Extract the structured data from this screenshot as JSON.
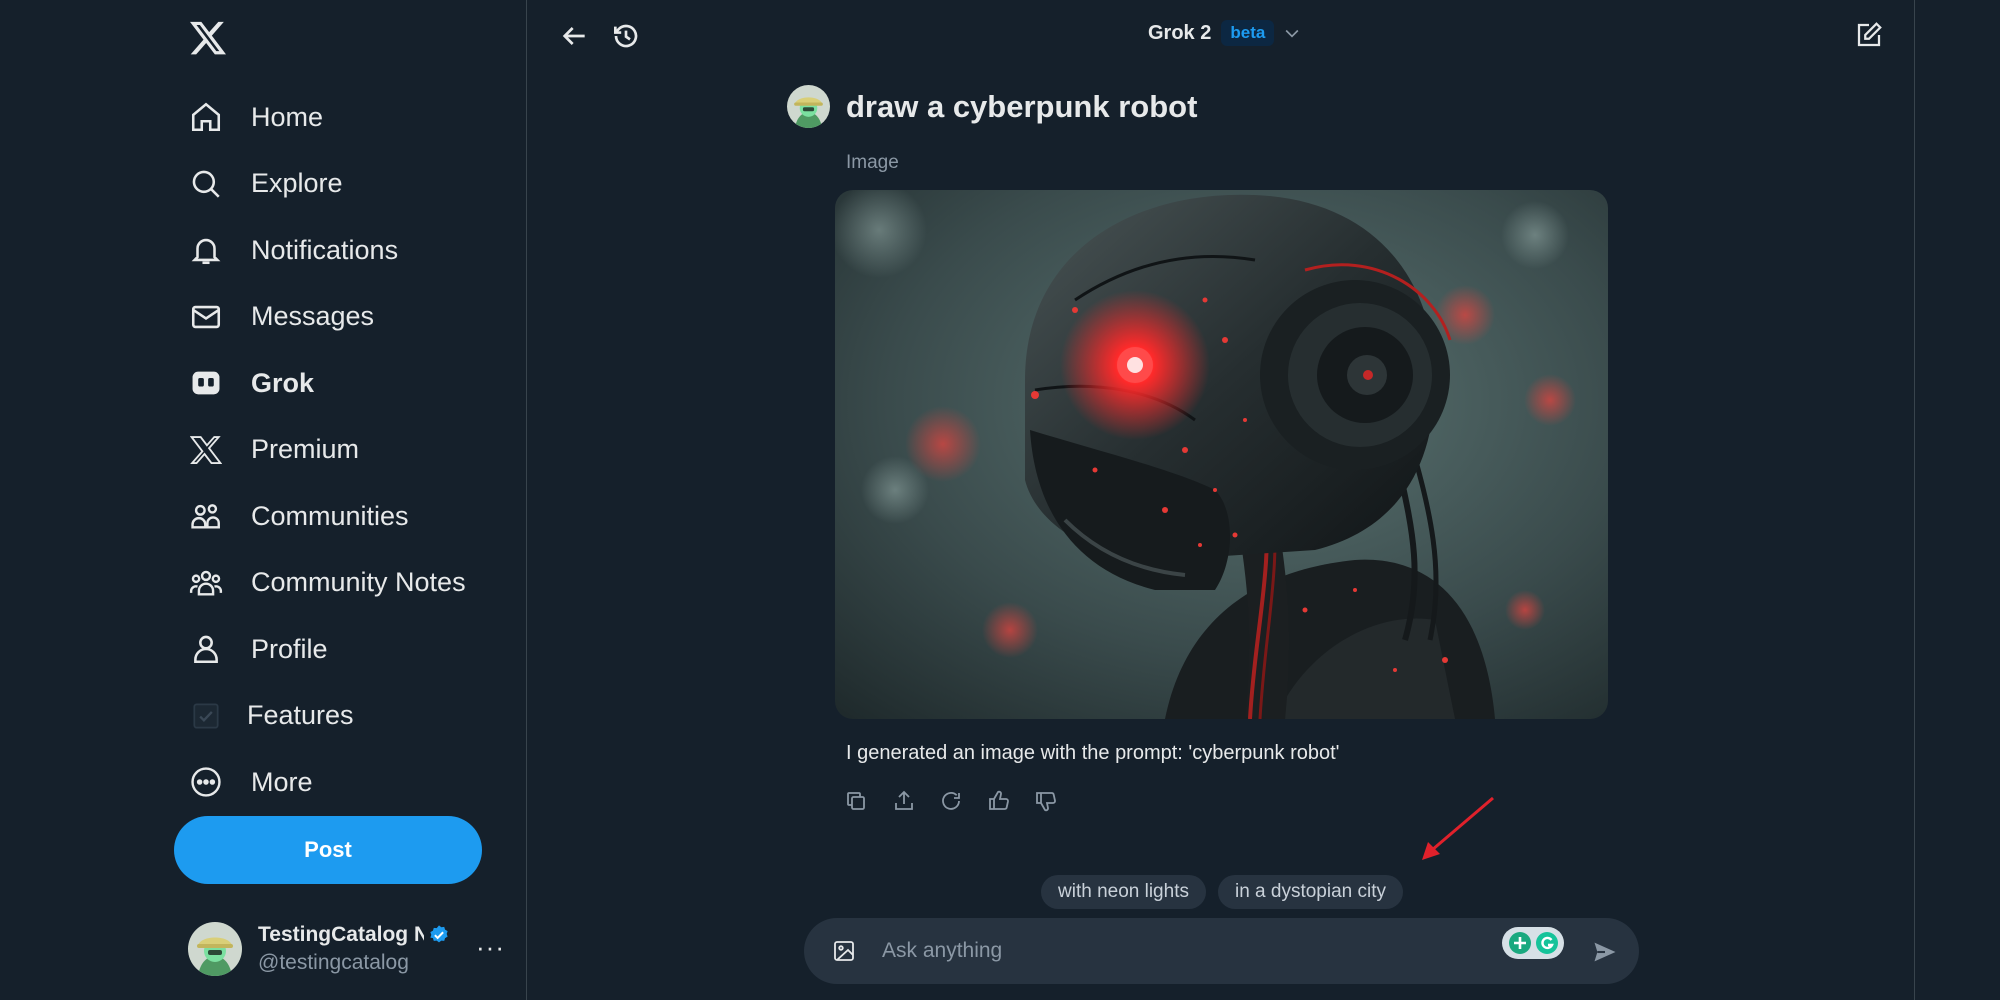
{
  "sidebar": {
    "nav": [
      {
        "label": "Home",
        "icon": "home-icon"
      },
      {
        "label": "Explore",
        "icon": "search-icon"
      },
      {
        "label": "Notifications",
        "icon": "bell-icon"
      },
      {
        "label": "Messages",
        "icon": "envelope-icon"
      },
      {
        "label": "Grok",
        "icon": "grok-icon",
        "active": true
      },
      {
        "label": "Premium",
        "icon": "x-logo-icon"
      },
      {
        "label": "Communities",
        "icon": "communities-icon"
      },
      {
        "label": "Community Notes",
        "icon": "community-notes-icon"
      },
      {
        "label": "Profile",
        "icon": "person-icon"
      },
      {
        "label": "Features",
        "icon": "checkbox-icon"
      },
      {
        "label": "More",
        "icon": "more-circle-icon"
      }
    ],
    "post_label": "Post",
    "account": {
      "name": "TestingCatalog Ne",
      "handle": "@testingcatalog",
      "more": "···"
    }
  },
  "header": {
    "model_name": "Grok 2",
    "badge": "beta"
  },
  "conversation": {
    "prompt": "draw a cyberpunk robot",
    "image_label": "Image",
    "response": "I generated an image with the prompt: 'cyberpunk robot'"
  },
  "suggestions": [
    "with neon lights",
    "in a dystopian city"
  ],
  "composer": {
    "placeholder": "Ask anything"
  },
  "colors": {
    "background": "#15202b",
    "accent": "#1d9bf0",
    "chip": "#273340",
    "annotation_arrow": "#e0212b"
  }
}
